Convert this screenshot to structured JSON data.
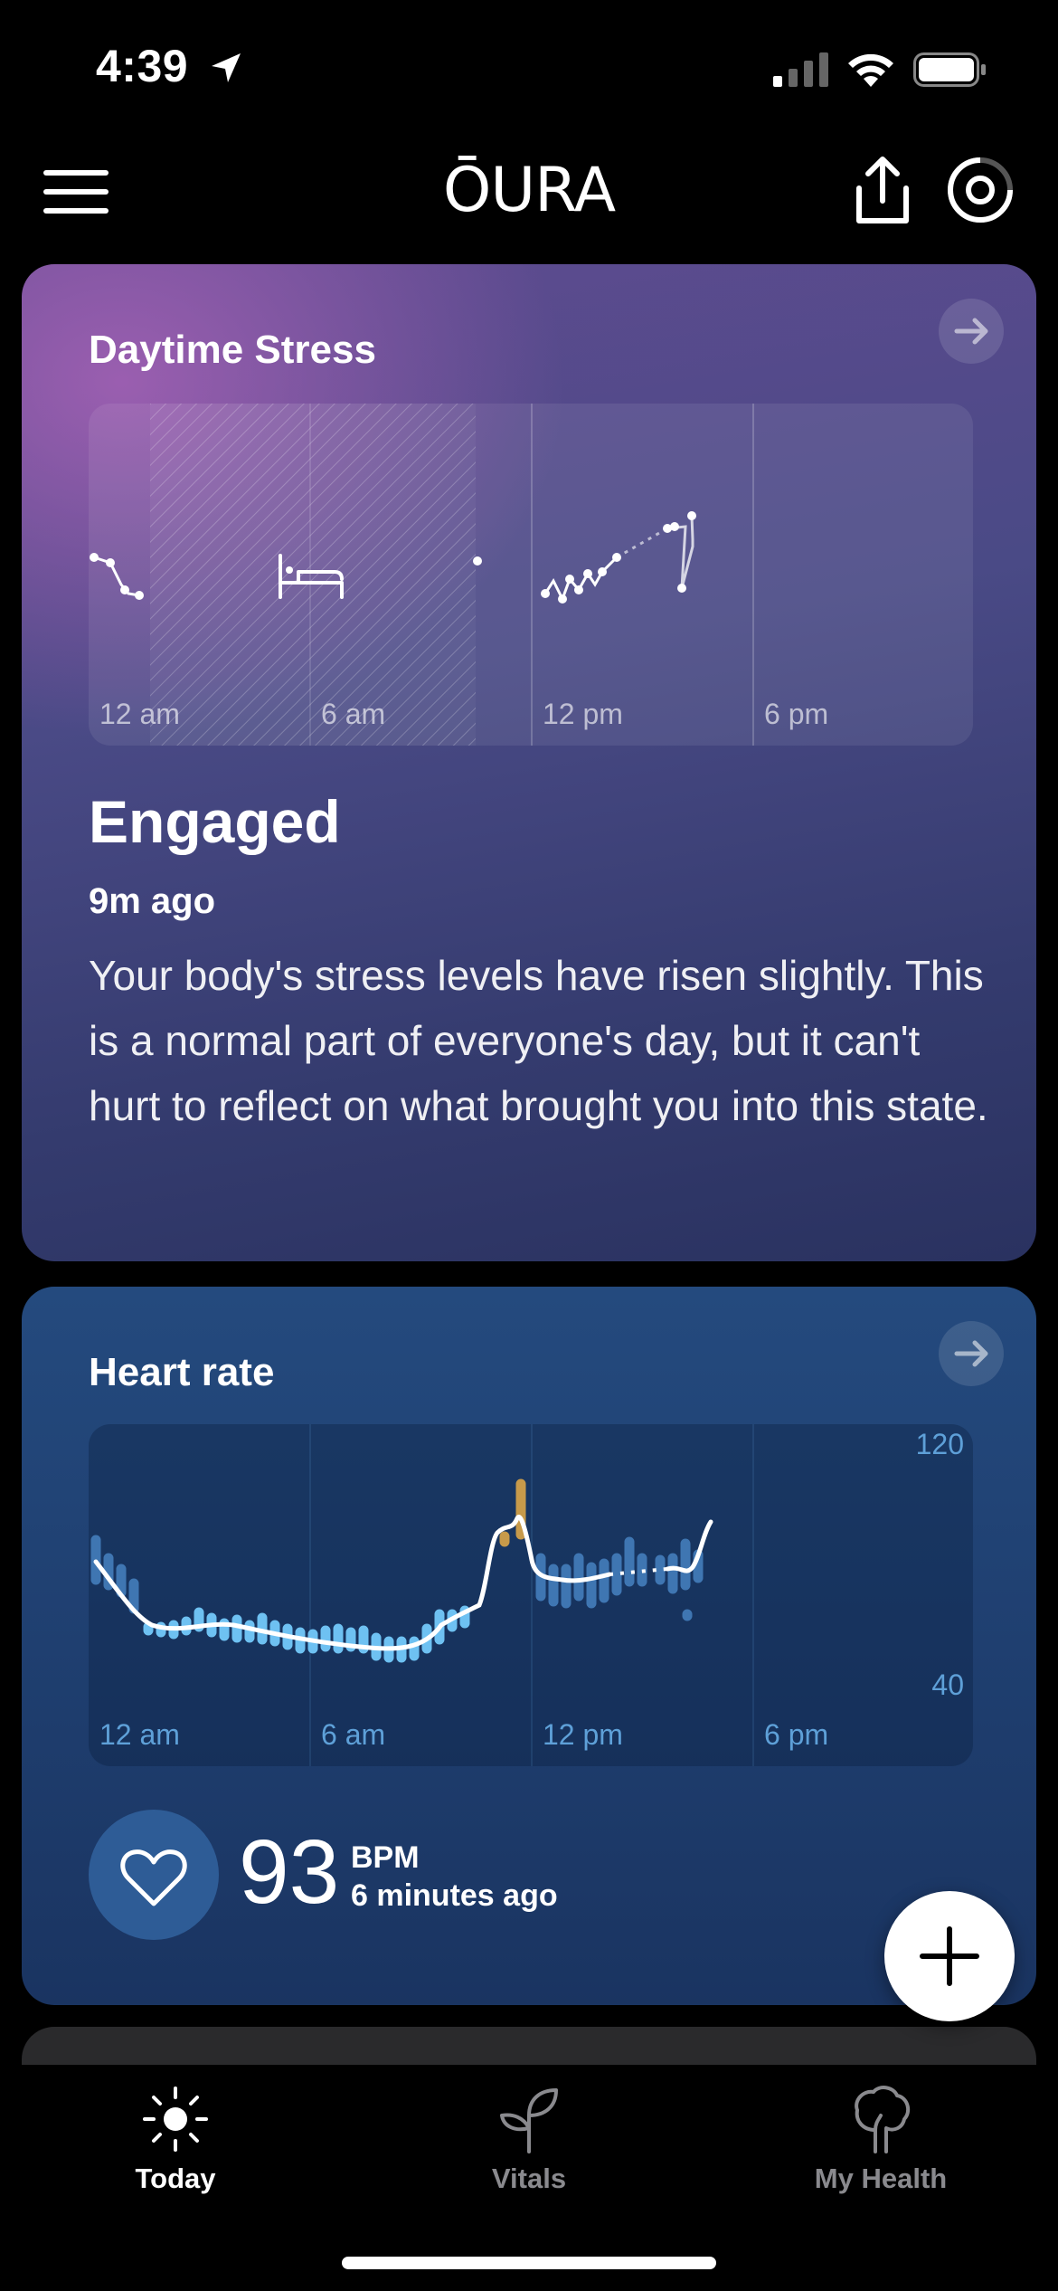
{
  "status_bar": {
    "time": "4:39"
  },
  "header": {
    "logo": "ŌURA"
  },
  "stress_card": {
    "title": "Daytime Stress",
    "ticks": [
      "12 am",
      "6 am",
      "12 pm",
      "6 pm"
    ],
    "state": "Engaged",
    "time_ago": "9m ago",
    "description": "Your body's stress levels have risen slightly. This is a normal part of everyone's day, but it can't hurt to reflect on what brought you into this state."
  },
  "heart_card": {
    "title": "Heart rate",
    "ticks": [
      "12 am",
      "6 am",
      "12 pm",
      "6 pm"
    ],
    "y_max": "120",
    "y_min": "40",
    "value": "93",
    "unit": "BPM",
    "time_ago": "6 minutes ago"
  },
  "tabs": [
    {
      "label": "Today",
      "icon": "sun-icon",
      "active": true
    },
    {
      "label": "Vitals",
      "icon": "sprout-icon",
      "active": false
    },
    {
      "label": "My Health",
      "icon": "tree-icon",
      "active": false
    }
  ],
  "colors": {
    "stress_card_purple": "#a662b6",
    "heart_card_blue": "#244a7e",
    "hr_light_bar": "#6ec1f2",
    "hr_high_bar": "#c79a4a"
  }
}
